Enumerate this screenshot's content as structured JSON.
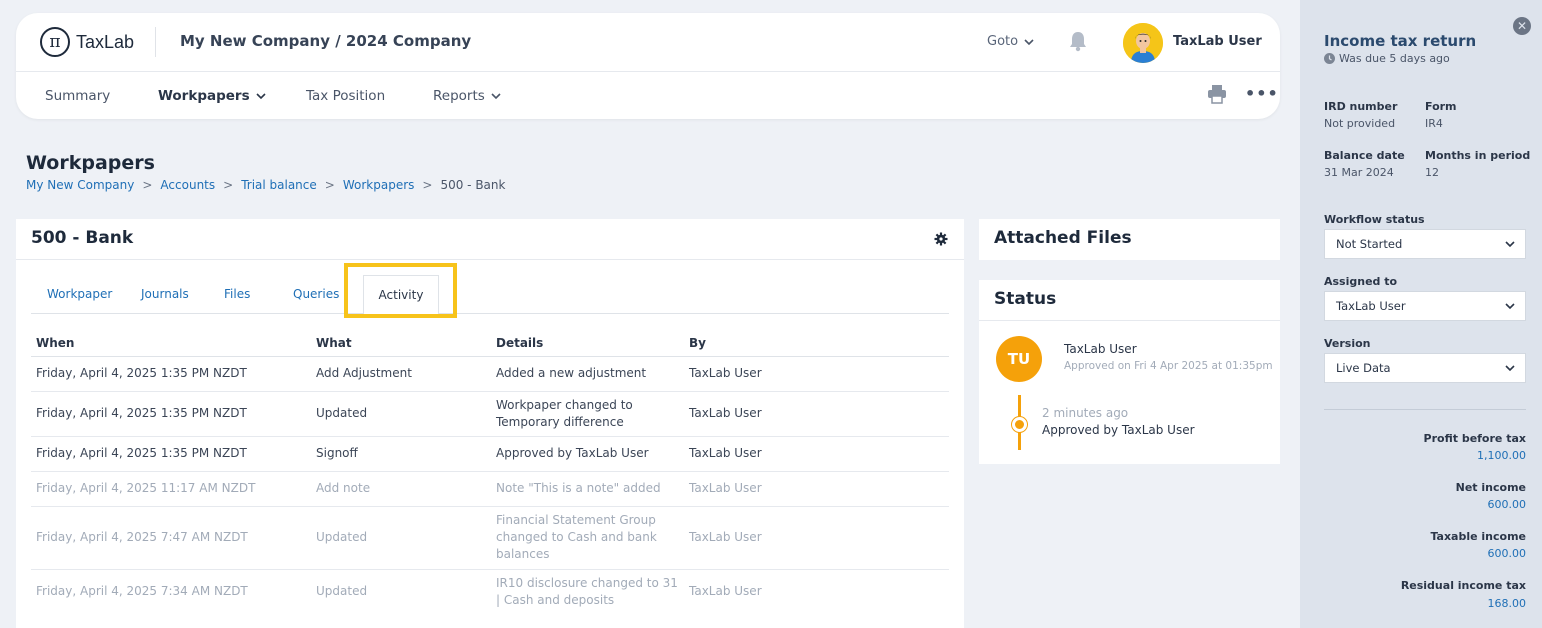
{
  "header": {
    "logo_symbol": "π",
    "logo_text": "TaxLab",
    "company_title": "My New Company / 2024 Company",
    "goto_label": "Goto",
    "user_name": "TaxLab User"
  },
  "nav": {
    "items": [
      {
        "label": "Summary"
      },
      {
        "label": "Workpapers"
      },
      {
        "label": "Tax Position"
      },
      {
        "label": "Reports"
      }
    ]
  },
  "page": {
    "title": "Workpapers",
    "breadcrumb": [
      "My New Company",
      "Accounts",
      "Trial balance",
      "Workpapers",
      "500 - Bank"
    ]
  },
  "workpaper": {
    "title": "500 - Bank",
    "tabs": [
      "Workpaper",
      "Journals",
      "Files",
      "Queries",
      "Activity"
    ],
    "active_tab": "Activity",
    "columns": [
      "When",
      "What",
      "Details",
      "By"
    ],
    "rows": [
      {
        "when": "Friday, April 4, 2025 1:35 PM NZDT",
        "what": "Add Adjustment",
        "details": "Added a new adjustment",
        "by": "TaxLab User"
      },
      {
        "when": "Friday, April 4, 2025 1:35 PM NZDT",
        "what": "Updated",
        "details": "Workpaper changed to Temporary difference",
        "by": "TaxLab User"
      },
      {
        "when": "Friday, April 4, 2025 1:35 PM NZDT",
        "what": "Signoff",
        "details": "Approved by TaxLab User",
        "by": "TaxLab User"
      },
      {
        "when": "Friday, April 4, 2025 11:17 AM NZDT",
        "what": "Add note",
        "details": "Note \"This is a note\" added",
        "by": "TaxLab User"
      },
      {
        "when": "Friday, April 4, 2025 7:47 AM NZDT",
        "what": "Updated",
        "details": "Financial Statement Group changed to Cash and bank balances",
        "by": "TaxLab User"
      },
      {
        "when": "Friday, April 4, 2025 7:34 AM NZDT",
        "what": "Updated",
        "details": "IR10 disclosure changed to 31 | Cash and deposits",
        "by": "TaxLab User"
      }
    ]
  },
  "attached_files": {
    "title": "Attached Files"
  },
  "status": {
    "title": "Status",
    "avatar_initials": "TU",
    "user": "TaxLab User",
    "approved": "Approved on Fri 4 Apr 2025 at 01:35pm",
    "timeline_time": "2 minutes ago",
    "timeline_text": "Approved by TaxLab User"
  },
  "side_panel": {
    "title": "Income tax return",
    "due": "Was due 5 days ago",
    "ird_label": "IRD number",
    "ird_value": "Not provided",
    "form_label": "Form",
    "form_value": "IR4",
    "balance_label": "Balance date",
    "balance_value": "31 Mar 2024",
    "months_label": "Months in period",
    "months_value": "12",
    "workflow_label": "Workflow status",
    "workflow_value": "Not Started",
    "assigned_label": "Assigned to",
    "assigned_value": "TaxLab User",
    "version_label": "Version",
    "version_value": "Live Data",
    "metrics": [
      {
        "label": "Profit before tax",
        "value": "1,100.00"
      },
      {
        "label": "Net income",
        "value": "600.00"
      },
      {
        "label": "Taxable income",
        "value": "600.00"
      },
      {
        "label": "Residual income tax",
        "value": "168.00"
      }
    ]
  },
  "colors": {
    "accent": "#1f6fb6",
    "highlight": "#f7c31a",
    "status_orange": "#f5a10a",
    "side_panel_bg": "#dde3ec"
  }
}
